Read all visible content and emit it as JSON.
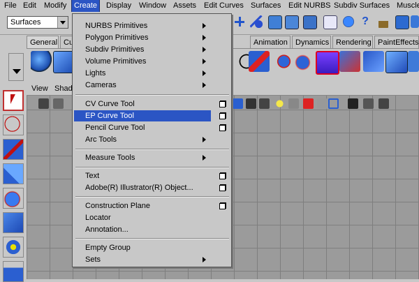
{
  "menubar": {
    "items": [
      "File",
      "Edit",
      "Modify",
      "Create",
      "Display",
      "Window",
      "Assets",
      "Edit Curves",
      "Surfaces",
      "Edit NURBS",
      "Subdiv Surfaces",
      "Muscle"
    ],
    "active_index": 3
  },
  "mode_selector": {
    "value": "Surfaces"
  },
  "shelf_tabs": [
    "General",
    "Cu",
    "Animation",
    "Dynamics",
    "Rendering",
    "PaintEffects"
  ],
  "viewport_menu": [
    "View",
    "Shad"
  ],
  "create_menu": {
    "items": [
      {
        "label": "NURBS Primitives",
        "submenu": true
      },
      {
        "label": "Polygon Primitives",
        "submenu": true
      },
      {
        "label": "Subdiv Primitives",
        "submenu": true
      },
      {
        "label": "Volume Primitives",
        "submenu": true
      },
      {
        "label": "Lights",
        "submenu": true
      },
      {
        "label": "Cameras",
        "submenu": true
      },
      {
        "label": "CV Curve Tool",
        "option": true
      },
      {
        "label": "EP Curve Tool",
        "option": true,
        "highlighted": true
      },
      {
        "label": "Pencil Curve Tool",
        "option": true
      },
      {
        "label": "Arc Tools",
        "submenu": true
      },
      {
        "label": "Measure Tools",
        "submenu": true
      },
      {
        "label": "Text",
        "option": true
      },
      {
        "label": "Adobe(R) Illustrator(R) Object...",
        "option": true
      },
      {
        "label": "Construction Plane",
        "option": true
      },
      {
        "label": "Locator"
      },
      {
        "label": "Annotation..."
      },
      {
        "label": "Empty Group"
      },
      {
        "label": "Sets",
        "submenu": true
      }
    ]
  },
  "colors": {
    "highlight": "#2b55c4",
    "chrome": "#c8c8c8",
    "viewport": "#9b9b9b"
  }
}
